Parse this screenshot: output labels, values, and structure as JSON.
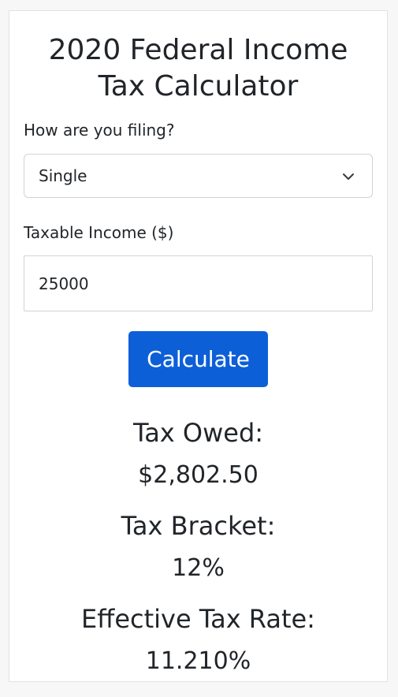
{
  "title_line1": "2020 Federal Income",
  "title_line2": "Tax Calculator",
  "filing": {
    "label": "How are you filing?",
    "selected": "Single"
  },
  "income": {
    "label": "Taxable Income ($)",
    "value": "25000"
  },
  "calculate_label": "Calculate",
  "results": {
    "tax_owed_label": "Tax Owed:",
    "tax_owed_value": "$2,802.50",
    "bracket_label": "Tax Bracket:",
    "bracket_value": "12%",
    "effective_label": "Effective Tax Rate:",
    "effective_value": "11.210%"
  },
  "colors": {
    "accent": "#0d5fd8",
    "background": "#f7f7f7",
    "card": "#ffffff"
  }
}
